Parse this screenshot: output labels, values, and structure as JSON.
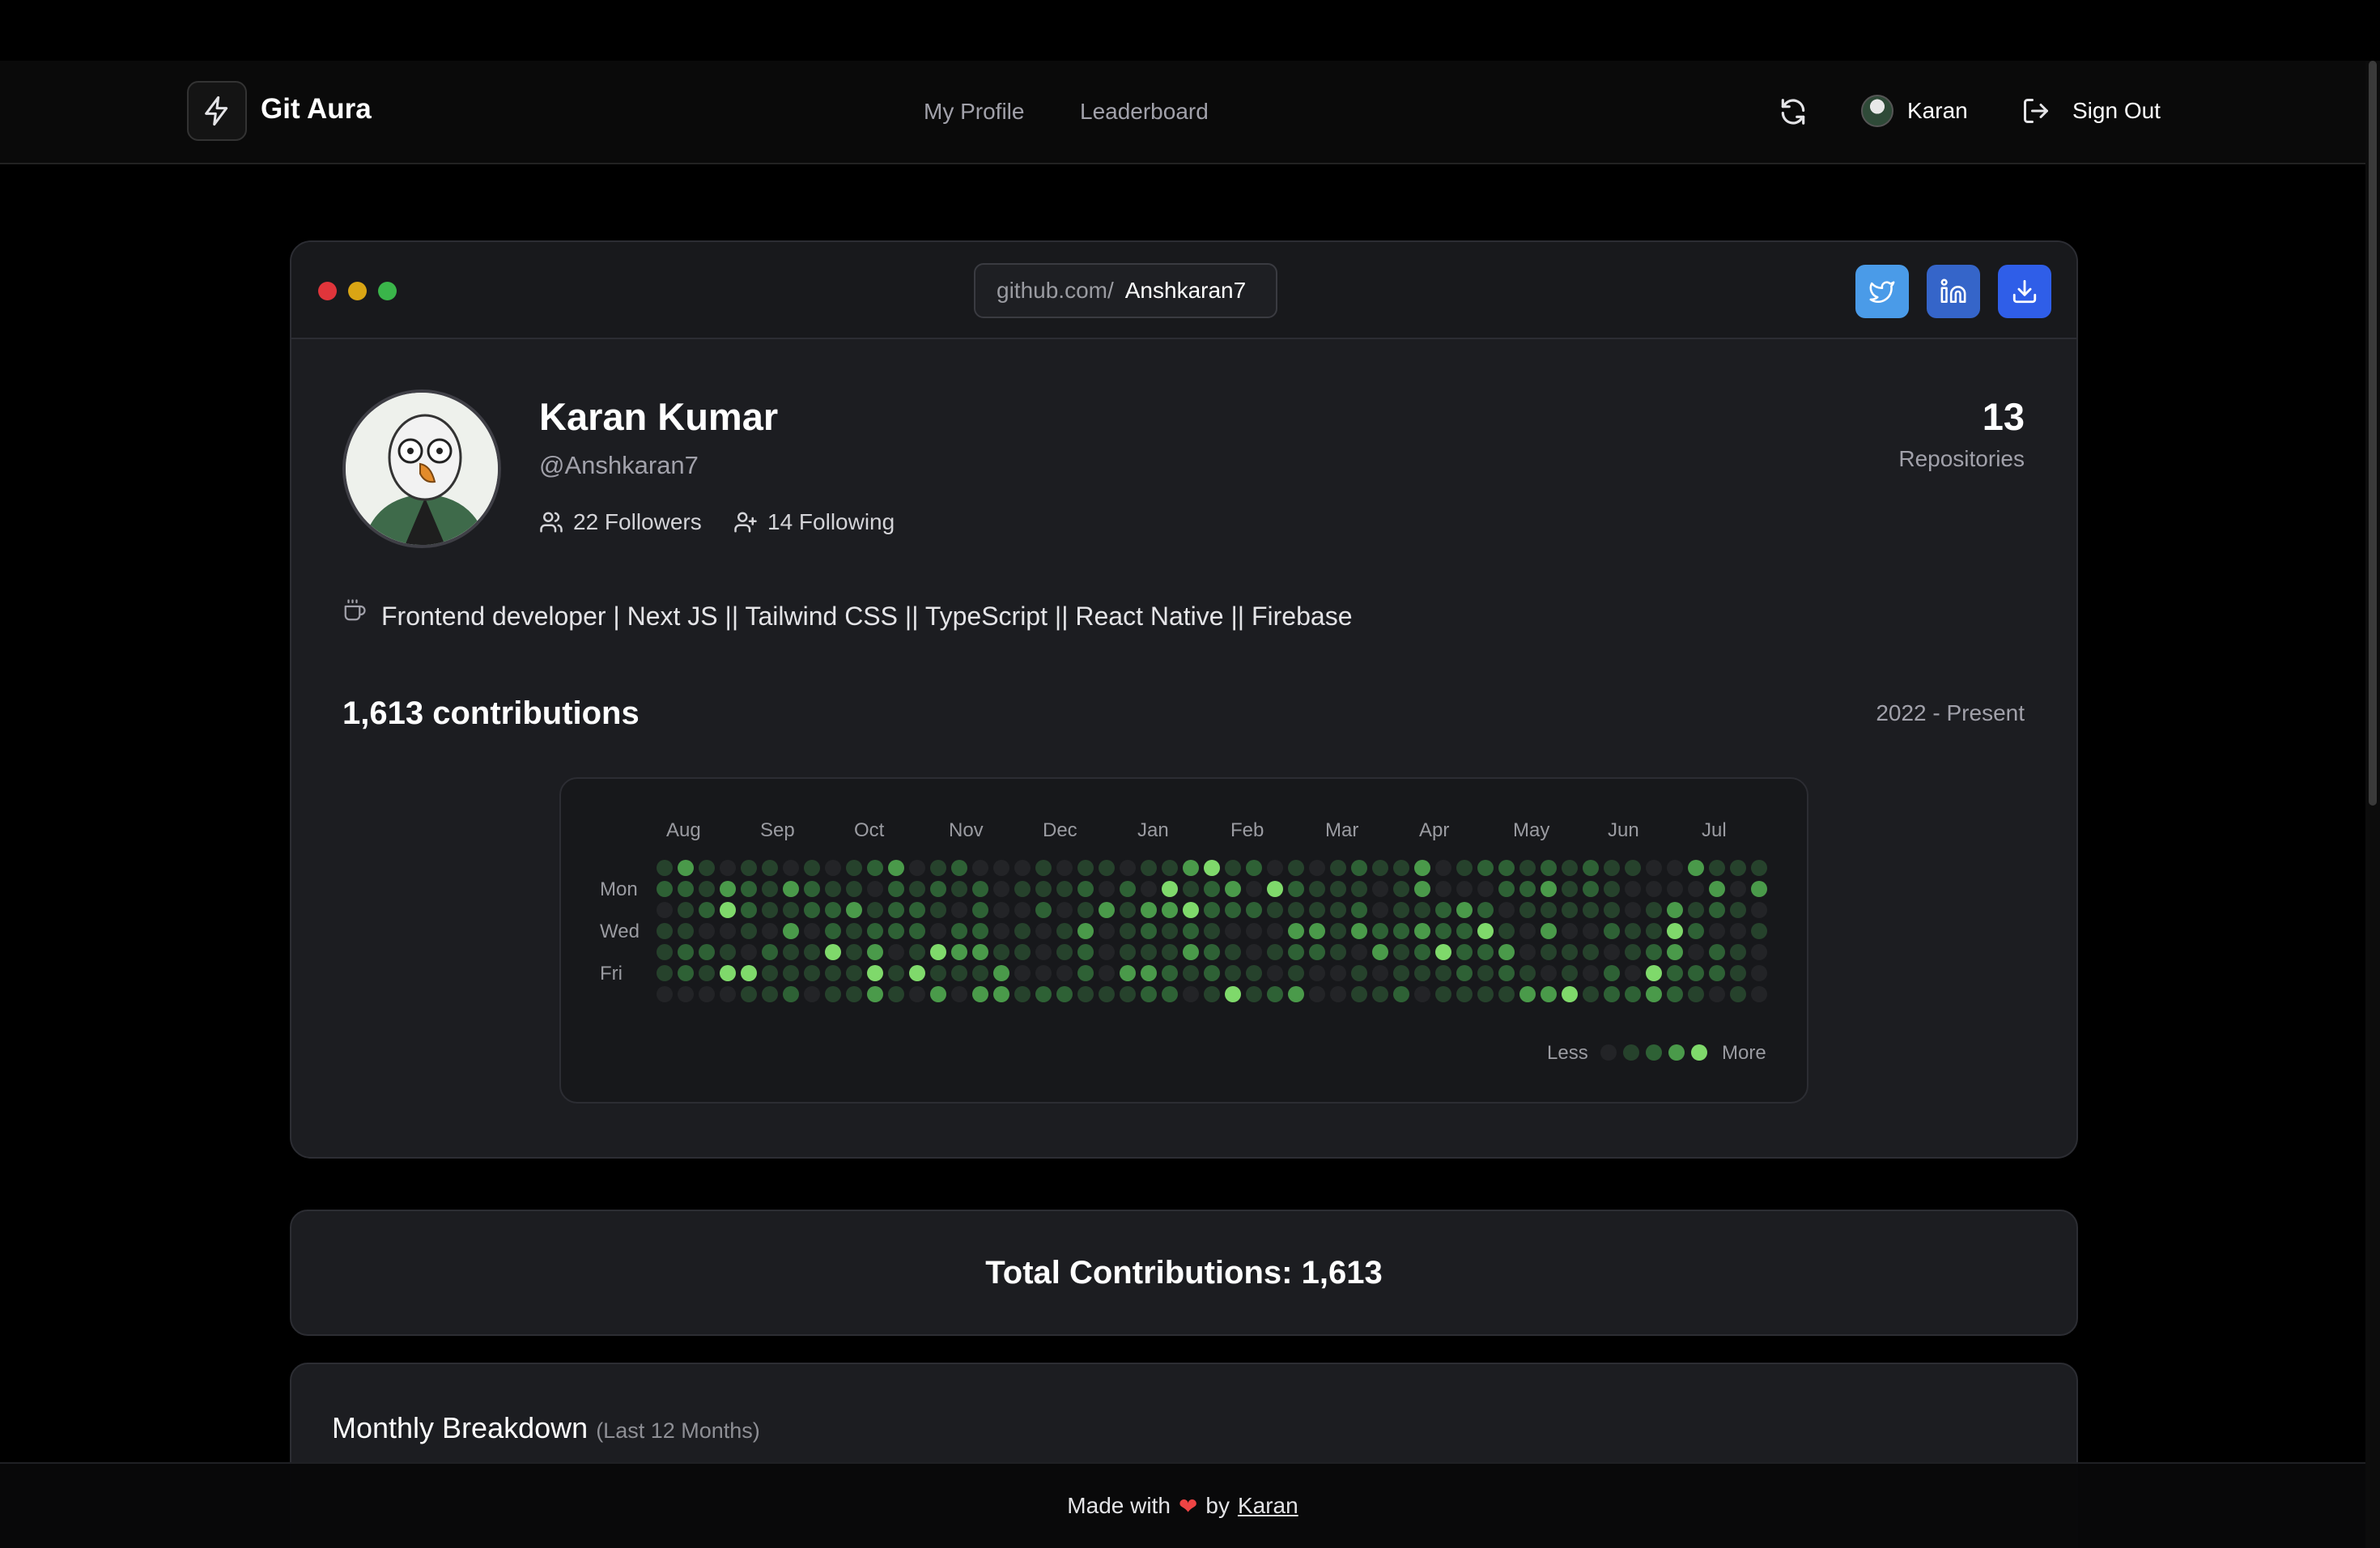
{
  "app": {
    "brand": "Git Aura"
  },
  "nav": {
    "links": [
      "My Profile",
      "Leaderboard"
    ],
    "user_name": "Karan",
    "signout_label": "Sign Out"
  },
  "card": {
    "url_prefix": "github.com/",
    "url_user": "Anshkaran7",
    "share_buttons": [
      "twitter-icon",
      "linkedin-icon",
      "download-icon"
    ]
  },
  "profile": {
    "name": "Karan Kumar",
    "handle": "@Anshkaran7",
    "followers": "22 Followers",
    "following": "14 Following",
    "repo_count": "13",
    "repo_label": "Repositories",
    "bio": "Frontend developer | Next JS || Tailwind CSS || TypeScript || React Native || Firebase"
  },
  "contributions": {
    "title": "1,613 contributions",
    "range": "2022 - Present",
    "months": [
      "Aug",
      "Sep",
      "Oct",
      "Nov",
      "Dec",
      "Jan",
      "Feb",
      "Mar",
      "Apr",
      "May",
      "Jun",
      "Jul"
    ],
    "day_labels": [
      "Mon",
      "Wed",
      "Fri"
    ],
    "legend_less": "Less",
    "legend_more": "More"
  },
  "colors": {
    "level0": "#232427",
    "level1": "#26422c",
    "level2": "#2e6135",
    "level3": "#4a9a4a",
    "level4": "#7fd96b"
  },
  "total": {
    "text": "Total Contributions: 1,613"
  },
  "monthly": {
    "title": "Monthly Breakdown",
    "subtitle": "(Last 12 Months)"
  },
  "footer": {
    "made_with": "Made with",
    "by": "by",
    "author": "Karan"
  }
}
